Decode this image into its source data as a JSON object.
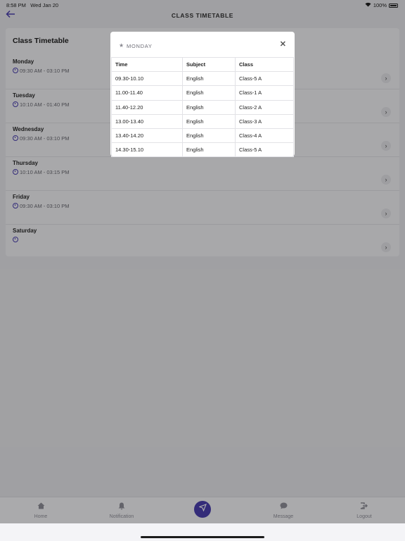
{
  "status": {
    "time": "8:58 PM",
    "date": "Wed Jan 20",
    "battery": "100%"
  },
  "header": {
    "title": "CLASS TIMETABLE"
  },
  "card": {
    "title": "Class Timetable",
    "days": [
      {
        "name": "Monday",
        "time": "09:30 AM - 03:10 PM"
      },
      {
        "name": "Tuesday",
        "time": "10:10 AM - 01:40 PM"
      },
      {
        "name": "Wednesday",
        "time": "09:30 AM - 03:10 PM"
      },
      {
        "name": "Thursday",
        "time": "10:10 AM - 03:15 PM"
      },
      {
        "name": "Friday",
        "time": "09:30 AM - 03:10 PM"
      },
      {
        "name": "Saturday",
        "time": ""
      }
    ]
  },
  "modal": {
    "title": "MONDAY",
    "columns": [
      "Time",
      "Subject",
      "Class"
    ],
    "rows": [
      [
        "09.30-10.10",
        "English",
        "Class-5 A"
      ],
      [
        "11.00-11.40",
        "English",
        "Class-1 A"
      ],
      [
        "11.40-12.20",
        "English",
        "Class-2 A"
      ],
      [
        "13.00-13.40",
        "English",
        "Class-3 A"
      ],
      [
        "13.40-14.20",
        "English",
        "Class-4 A"
      ],
      [
        "14.30-15.10",
        "English",
        "Class-5 A"
      ]
    ]
  },
  "tabbar": {
    "home": "Home",
    "notification": "Notification",
    "message": "Message",
    "logout": "Logout"
  },
  "colors": {
    "accent": "#4b3fae"
  }
}
